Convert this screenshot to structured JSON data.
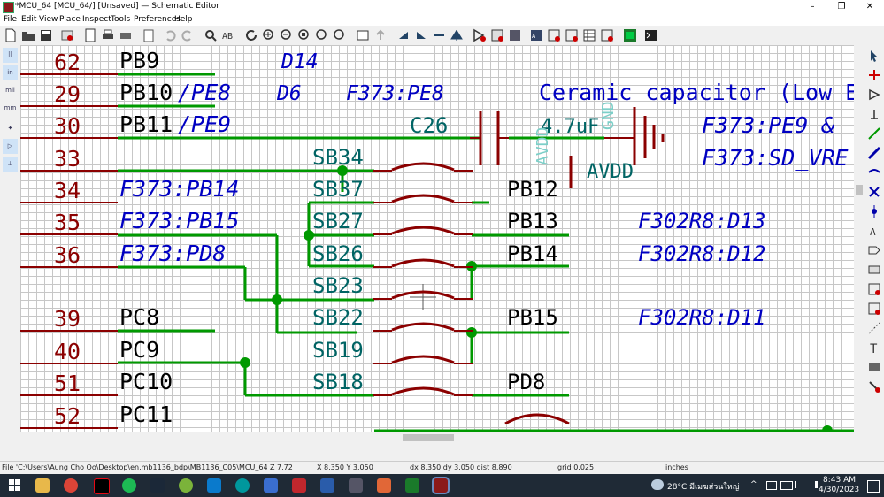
{
  "window": {
    "title": "*MCU_64 [MCU_64/] [Unsaved] — Schematic Editor",
    "controls": [
      "–",
      "❐",
      "✕"
    ]
  },
  "menu": [
    "File",
    "Edit",
    "View",
    "Place",
    "Inspect",
    "Tools",
    "Preferences",
    "Help"
  ],
  "left_toolbar": [
    "grid-dots",
    "in",
    "mil",
    "mm",
    "cursor",
    "hierarchy",
    "measure"
  ],
  "schematic": {
    "pin_numbers": [
      "62",
      "29",
      "30",
      "33",
      "34",
      "35",
      "36",
      "39",
      "40",
      "51",
      "52"
    ],
    "pin_labels": [
      "PB9",
      "PB10",
      "PB11",
      "PC8",
      "PC9",
      "PC10",
      "PC11"
    ],
    "alt_suffixes": [
      "/PE8",
      "/PE9"
    ],
    "blue_labels": [
      "F373:PB14",
      "F373:PB15",
      "F373:PD8"
    ],
    "top_notes": [
      "D14",
      "D6",
      "F373:PE8",
      "Ceramic capacitor (Low E",
      "F373:PE9 &",
      "F373:SD_VRE"
    ],
    "cap_ref": "C26",
    "cap_value": "4.7uF",
    "power_avdd": "AVDD",
    "power_avdd_rot": "AVDD",
    "power_gnd_rot": "GND",
    "solder_bridges": [
      "SB34",
      "SB37",
      "SB27",
      "SB26",
      "SB23",
      "SB22",
      "SB19",
      "SB18"
    ],
    "right_labels": [
      "PB12",
      "PB13",
      "PB14",
      "PB15",
      "PD8"
    ],
    "right_notes": [
      "F302R8:D13",
      "F302R8:D12",
      "F302R8:D11"
    ]
  },
  "status": {
    "file": "File 'C:\\Users\\Aung Cho Oo\\Desktop\\en.mb1136_bdp\\MB1136_C05\\MCU_64.kicad_sch...",
    "zoom": "Z 7.72",
    "cursor": "X 8.350  Y 3.050",
    "delta": "dx 8.350  dy 3.050  dist 8.890",
    "grid": "grid 0.025",
    "units": "inches"
  },
  "taskbar": {
    "weather": "28°C  มีเมฆส่วนใหญ่",
    "time": "8:43 AM",
    "date": "4/30/2023"
  },
  "colors": {
    "wire": "#009900",
    "pin": "#8b0000",
    "blue_text": "#0000c2",
    "ref_text": "#006464"
  }
}
